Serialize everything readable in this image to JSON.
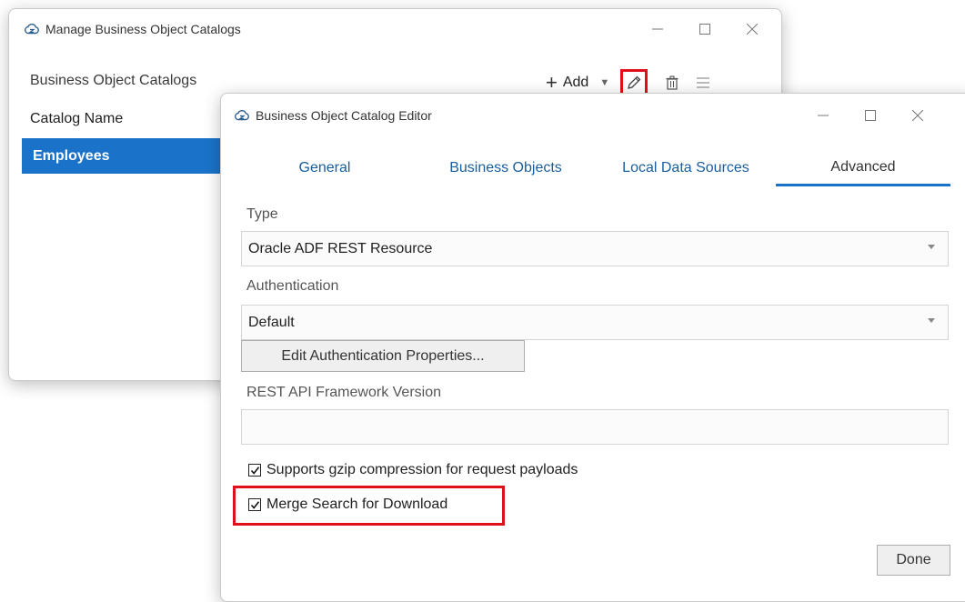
{
  "back_window": {
    "title": "Manage Business Object Catalogs",
    "section_label": "Business Object Catalogs",
    "toolbar": {
      "add_label": "Add"
    },
    "column_header": "Catalog Name",
    "rows": [
      "Employees"
    ]
  },
  "editor": {
    "title": "Business Object Catalog Editor",
    "tabs": [
      "General",
      "Business Objects",
      "Local Data Sources",
      "Advanced"
    ],
    "active_tab": "Advanced",
    "type_label": "Type",
    "type_value": "Oracle ADF REST Resource",
    "auth_label": "Authentication",
    "auth_value": "Default",
    "edit_auth_button": "Edit Authentication Properties...",
    "rest_version_label": "REST API Framework Version",
    "rest_version_value": "",
    "gzip_label": "Supports gzip compression for request payloads",
    "gzip_checked": true,
    "merge_label": "Merge Search for Download",
    "merge_checked": true,
    "done_button": "Done"
  },
  "colors": {
    "accent": "#1a73c9",
    "highlight": "#e0101a"
  }
}
